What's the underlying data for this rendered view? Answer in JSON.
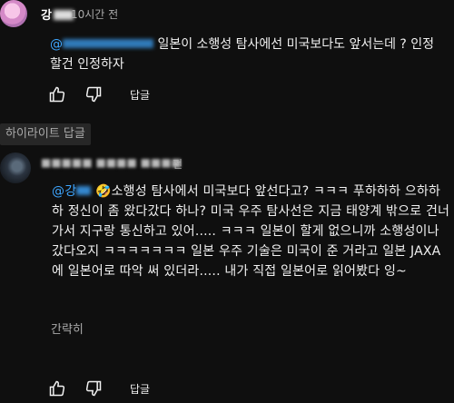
{
  "comments": [
    {
      "author": "강",
      "time": "10시간 전",
      "mention": "@",
      "text": "일본이 소행성 탐사에선 미국보다도 앞서는데 ? 인정할건 인정하자",
      "reply_label": "답글"
    },
    {
      "highlight_label": "하이라이트 답글",
      "time": "전",
      "mention": "@강",
      "emoji": "🤣",
      "text": "소행성 탐사에서 미국보다 앞선다고? ㅋㅋㅋ 푸하하하 으하하하 정신이 좀 왔다갔다 하나? 미국 우주 탐사선은 지금 태양계 밖으로 건너가서 지구랑 통신하고 있어..... ㅋㅋㅋ 일본이 할게 없으니까 소행성이나 갔다오지 ㅋㅋㅋㅋㅋㅋㅋ 일본 우주 기술은 미국이 준 거라고 일본 JAXA 에 일본어로 따악 써 있더라..... 내가 직접 일본어로 읽어봤다 잉~",
      "collapse_label": "간략히",
      "reply_label": "답글"
    }
  ],
  "icons": [
    "like-icon",
    "dislike-icon"
  ]
}
